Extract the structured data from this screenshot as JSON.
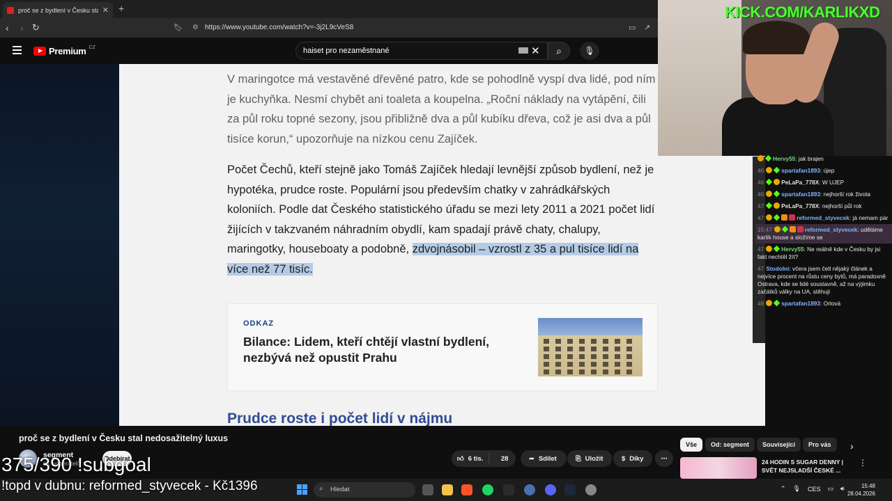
{
  "browser": {
    "tab_title": "proč se z bydlení v Česku stal ne",
    "url": "https://www.youtube.com/watch?v=-3j2L9cVeS8"
  },
  "youtube": {
    "logo_text": "Premium",
    "region": "CZ",
    "search_value": "haiset pro nezaměstnané"
  },
  "article": {
    "para1": "V maringotce má vestavěné dřevěné patro, kde se pohodlně vyspí dva lidé, pod ním je kuchyňka. Nesmí chybět ani toaleta a koupelna. „Roční náklady na vytápění, čili za půl roku topné sezony, jsou přibližně dva a půl kubíku dřeva, což je asi dva a půl tisíce korun,“ upozorňuje na nízkou cenu Zajíček.",
    "para2_plain": "Počet Čechů, kteří stejně jako Tomáš Zajíček hledají levnější způsob bydlení, než je hypotéka, prudce roste. Populární jsou především chatky v zahrádkářských koloniích. Podle dat Českého statistického úřadu se mezi lety 2011 a 2021 počet lidí žijících v takzvaném náhradním obydlí, kam spadají právě chaty, chalupy, maringotky, houseboaty a podobně, ",
    "para2_highlight": "zdvojnásobil – vzrostl z 35 a pul tisíce lidí na více než 77 tisíc.",
    "link_label": "ODKAZ",
    "link_title": "Bilance: Lidem, kteří chtějí vlastní bydlení, nezbývá než opustit Prahu",
    "next_heading": "Prudce roste i počet lidí v nájmu"
  },
  "stream": {
    "cam_title": "KICK.COM/KARLIKXD",
    "subgoal": "375/390 !subgoal",
    "ticker": "!topd v dubnu: reformed_styvecek - Kč1396"
  },
  "chat": [
    {
      "ts": "",
      "nick": "Hervy55",
      "color": "#7fd47f",
      "text": "jak brajen",
      "badges": [
        "gold",
        "green"
      ]
    },
    {
      "ts": "46",
      "nick": "spartafan1893",
      "color": "#7fb4ff",
      "text": "újep",
      "badges": [
        "gold",
        "green"
      ]
    },
    {
      "ts": "46",
      "nick": "PeLaPa_778X",
      "color": "#e0e0e0",
      "text": "W UJEP",
      "badges": [
        "green",
        "gold"
      ]
    },
    {
      "ts": "46",
      "nick": "spartafan1893",
      "color": "#7fb4ff",
      "text": "nejhorší rok života",
      "badges": [
        "gold",
        "green"
      ]
    },
    {
      "ts": "47",
      "nick": "PeLaPa_778X",
      "color": "#e0e0e0",
      "text": "nejhorší půl rok",
      "badges": [
        "green",
        "gold"
      ]
    },
    {
      "ts": "47",
      "nick": "reformed_styvecek",
      "color": "#7fb4ff",
      "text": "já nemam pár",
      "badges": [
        "gold",
        "green",
        "orange",
        "red"
      ]
    },
    {
      "ts": "15:47",
      "nick": "reformed_styvecek",
      "color": "#7fb4ff",
      "text": "uděláme karlík house a složíme se",
      "badges": [
        "gold",
        "green",
        "orange",
        "red"
      ],
      "highlight": true
    },
    {
      "ts": "47",
      "nick": "Hervy55",
      "color": "#7fd47f",
      "text": "Ne reálně kde v Česku by jsi fakt nechtěl žít?",
      "badges": [
        "gold",
        "green"
      ]
    },
    {
      "ts": "47",
      "nick": "Stodolni",
      "color": "#7fb4ff",
      "text": "včera jsem četl nějaký článek a nejvíce procent na růstu ceny bytů, má paradoxně Ostrava, kde se lidé soustavně, až na výjimku začátků války na UA, stěhují",
      "badges": []
    },
    {
      "ts": "48",
      "nick": "spartafan1893",
      "color": "#7fb4ff",
      "text": "Orlová",
      "badges": [
        "gold",
        "green"
      ]
    }
  ],
  "video": {
    "title": "proč se z bydlení v Česku stal nedosažitelný luxus",
    "channel": "segment",
    "subscribers": "tis. odběratelů",
    "subscribe_label": "Odebírat",
    "likes": "6 tis.",
    "dislikes": "28",
    "share_label": "Sdílet",
    "save_label": "Uložit",
    "thanks_label": "Díky"
  },
  "sidebar": {
    "chips": [
      {
        "label": "Vše",
        "active": true
      },
      {
        "label": "Od: segment",
        "active": false
      },
      {
        "label": "Související",
        "active": false
      },
      {
        "label": "Pro vás",
        "active": false
      }
    ],
    "reco_title": "24 HODIN S SUGAR DENNY | SVĚT NEJSLADŠÍ ČESKÉ ..."
  },
  "taskbar": {
    "search_placeholder": "Hledat",
    "lang": "CES",
    "time": "15:48",
    "date": "28.04.2026"
  },
  "colors": {
    "yt_red": "#ff0000",
    "kick_green": "#53fc18",
    "highlight_blue": "#b4cbe6",
    "link_blue": "#1a3a8a"
  }
}
